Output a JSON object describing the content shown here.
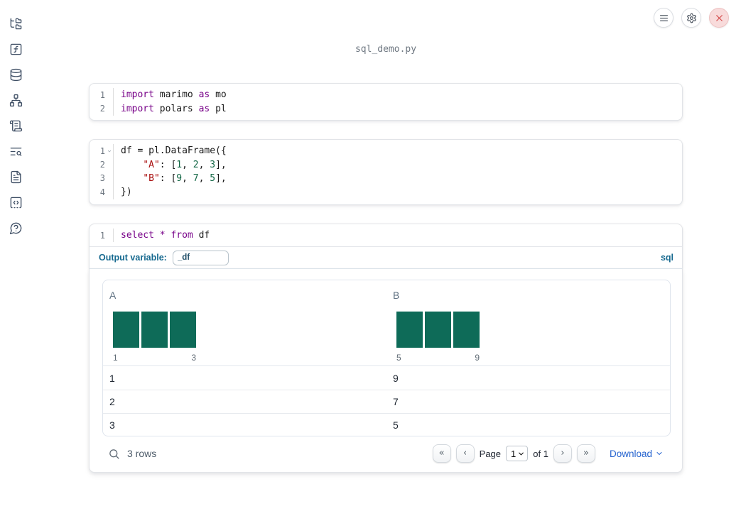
{
  "app": {
    "filename": "sql_demo.py"
  },
  "topbar": {
    "icons": [
      "hamburger-icon",
      "gear-icon",
      "close-icon"
    ]
  },
  "sidebar": {
    "items": [
      "file-tree-icon",
      "function-square-icon",
      "database-icon",
      "network-graph-icon",
      "scroll-text-icon",
      "list-search-icon",
      "file-text-icon",
      "code-snippet-icon",
      "help-question-icon"
    ]
  },
  "cells": [
    {
      "type": "code",
      "lines": [
        {
          "n": "1",
          "tokens": [
            [
              "kw",
              "import"
            ],
            [
              "pl",
              " marimo "
            ],
            [
              "kw",
              "as"
            ],
            [
              "pl",
              " mo"
            ]
          ]
        },
        {
          "n": "2",
          "tokens": [
            [
              "kw",
              "import"
            ],
            [
              "pl",
              " polars "
            ],
            [
              "kw",
              "as"
            ],
            [
              "pl",
              " pl"
            ]
          ]
        }
      ]
    },
    {
      "type": "code",
      "lines": [
        {
          "n": "1",
          "fold": true,
          "tokens": [
            [
              "pl",
              "df = pl.DataFrame({"
            ]
          ]
        },
        {
          "n": "2",
          "tokens": [
            [
              "pl",
              "    "
            ],
            [
              "str",
              "\"A\""
            ],
            [
              "pl",
              ": ["
            ],
            [
              "num",
              "1"
            ],
            [
              "pl",
              ", "
            ],
            [
              "num",
              "2"
            ],
            [
              "pl",
              ", "
            ],
            [
              "num",
              "3"
            ],
            [
              "pl",
              "],"
            ]
          ]
        },
        {
          "n": "3",
          "tokens": [
            [
              "pl",
              "    "
            ],
            [
              "str",
              "\"B\""
            ],
            [
              "pl",
              ": ["
            ],
            [
              "num",
              "9"
            ],
            [
              "pl",
              ", "
            ],
            [
              "num",
              "7"
            ],
            [
              "pl",
              ", "
            ],
            [
              "num",
              "5"
            ],
            [
              "pl",
              "],"
            ]
          ]
        },
        {
          "n": "4",
          "tokens": [
            [
              "pl",
              "})"
            ]
          ]
        }
      ]
    },
    {
      "type": "sql",
      "lines": [
        {
          "n": "1",
          "tokens": [
            [
              "kw",
              "select"
            ],
            [
              "pl",
              " "
            ],
            [
              "kw",
              "*"
            ],
            [
              "pl",
              " "
            ],
            [
              "kw",
              "from"
            ],
            [
              "pl",
              " df"
            ]
          ]
        }
      ],
      "output_variable_label": "Output variable:",
      "output_variable_value": "_df",
      "language_badge": "sql"
    }
  ],
  "table": {
    "columns": [
      {
        "name": "A",
        "hist": {
          "type": "bar",
          "bars": [
            1,
            1,
            1
          ],
          "min_label": "1",
          "max_label": "3"
        }
      },
      {
        "name": "B",
        "hist": {
          "type": "bar",
          "bars": [
            1,
            1,
            1
          ],
          "min_label": "5",
          "max_label": "9"
        }
      }
    ],
    "rows": [
      [
        "1",
        "9"
      ],
      [
        "2",
        "7"
      ],
      [
        "3",
        "5"
      ]
    ],
    "footer": {
      "row_count": "3 rows",
      "page_label": "Page",
      "page_value": "1",
      "of_label": "of 1",
      "first_icon": "«",
      "prev_icon": "‹",
      "next_icon": "›",
      "last_icon": "»",
      "download_label": "Download"
    }
  },
  "colors": {
    "histogram_bar": "#0e6b58",
    "sql_accent": "#16698f",
    "keyword": "#770088",
    "number": "#116644",
    "string": "#aa1111",
    "link": "#2563cf",
    "close_button_bg": "#f8dbdb",
    "close_button_x": "#d24848"
  }
}
